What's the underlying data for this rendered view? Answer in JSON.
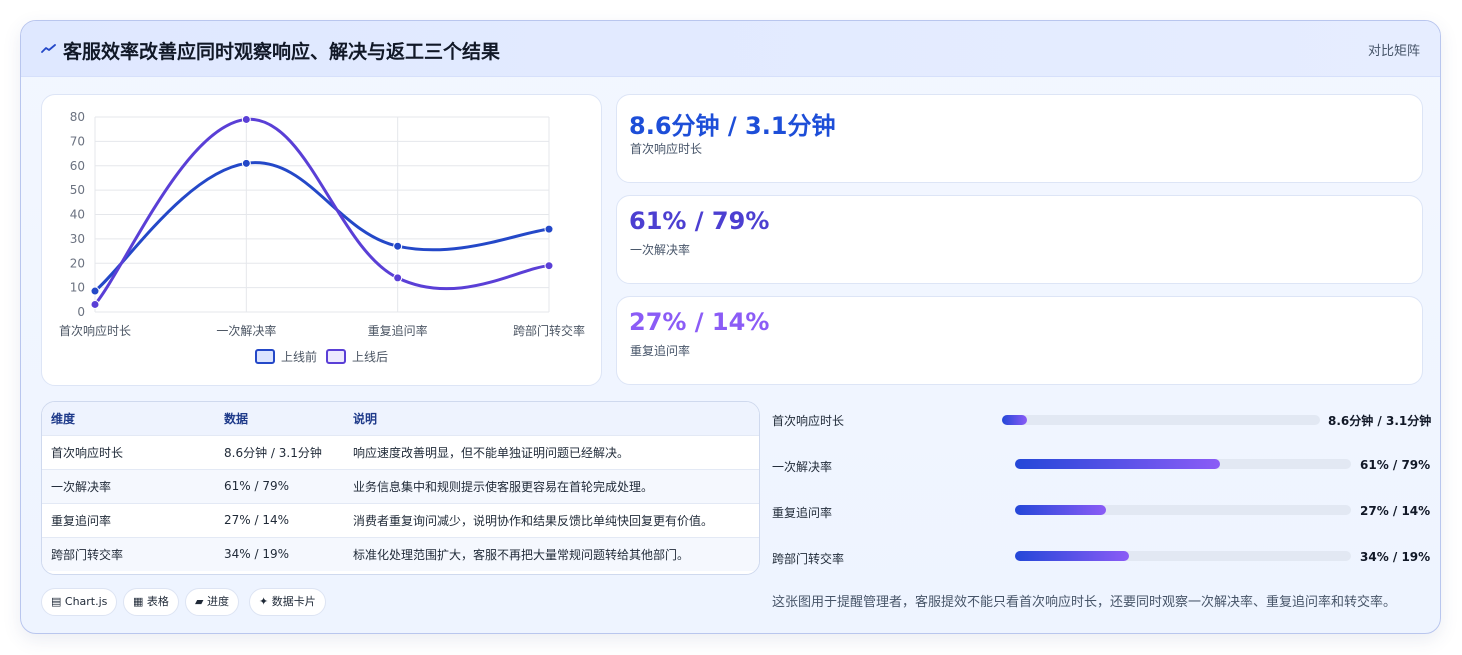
{
  "header": {
    "title": "客服效率改善应同时观察响应、解决与返工三个结果",
    "right_label": "对比矩阵",
    "icon": "chart-line-icon"
  },
  "colors": {
    "before": "#2448c8",
    "after": "#5a3fd6",
    "kpi1": "#1d4ed8",
    "kpi2": "#4c3fd1",
    "kpi3": "#8b5cf6"
  },
  "chart_data": {
    "type": "line",
    "categories": [
      "首次响应时长",
      "一次解决率",
      "重复追问率",
      "跨部门转交率"
    ],
    "series": [
      {
        "name": "上线前",
        "values": [
          8.6,
          61,
          27,
          34
        ]
      },
      {
        "name": "上线后",
        "values": [
          3.1,
          79,
          14,
          19
        ]
      }
    ],
    "ylim": [
      0,
      80
    ],
    "yticks": [
      "0",
      "10",
      "20",
      "30",
      "40",
      "50",
      "60",
      "70",
      "80"
    ],
    "grid": true,
    "legend": "bottom",
    "title": "",
    "xlabel": "",
    "ylabel": ""
  },
  "kpis": [
    {
      "value": "8.6分钟 / 3.1分钟",
      "label": "首次响应时长"
    },
    {
      "value": "61% / 79%",
      "label": "一次解决率"
    },
    {
      "value": "27% / 14%",
      "label": "重复追问率"
    }
  ],
  "table": {
    "headers": [
      "维度",
      "数据",
      "说明"
    ],
    "rows": [
      [
        "首次响应时长",
        "8.6分钟 / 3.1分钟",
        "响应速度改善明显，但不能单独证明问题已经解决。"
      ],
      [
        "一次解决率",
        "61% / 79%",
        "业务信息集中和规则提示使客服更容易在首轮完成处理。"
      ],
      [
        "重复追问率",
        "27% / 14%",
        "消费者重复询问减少，说明协作和结果反馈比单纯快回复更有价值。"
      ],
      [
        "跨部门转交率",
        "34% / 19%",
        "标准化处理范围扩大，客服不再把大量常规问题转给其他部门。"
      ]
    ]
  },
  "chips": [
    "▤ Chart.js",
    "▦ 表格",
    "▰ 进度",
    "✦ 数据卡片"
  ],
  "progress": [
    {
      "label": "首次响应时长",
      "value": "8.6分钟 / 3.1分钟",
      "fill": 0.08
    },
    {
      "label": "一次解决率",
      "value": "61% / 79%",
      "fill": 0.61
    },
    {
      "label": "重复追问率",
      "value": "27% / 14%",
      "fill": 0.27
    },
    {
      "label": "跨部门转交率",
      "value": "34% / 19%",
      "fill": 0.34
    }
  ],
  "note": "这张图用于提醒管理者，客服提效不能只看首次响应时长，还要同时观察一次解决率、重复追问率和转交率。"
}
